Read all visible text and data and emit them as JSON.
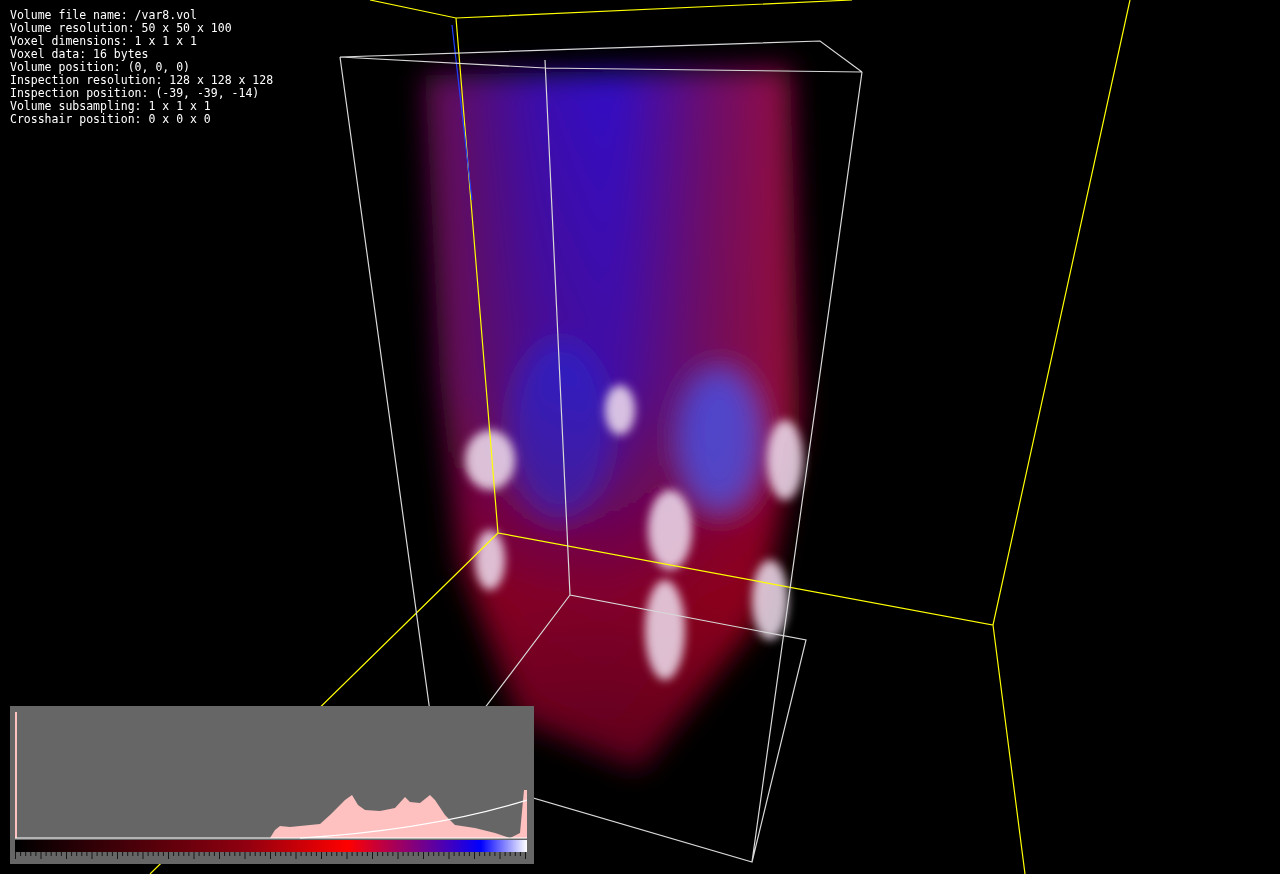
{
  "info_lines": [
    "Volume file name: /var8.vol",
    "Volume resolution: 50 x 50 x 100",
    "Voxel dimensions: 1 x 1 x 1",
    "Voxel data: 16 bytes",
    "Volume position: (0, 0, 0)",
    "Inspection resolution: 128 x 128 x 128",
    "Inspection position: (-39, -39, -14)",
    "Volume subsampling: 1 x 1 x 1",
    "Crosshair position: 0 x 0 x 0"
  ]
}
